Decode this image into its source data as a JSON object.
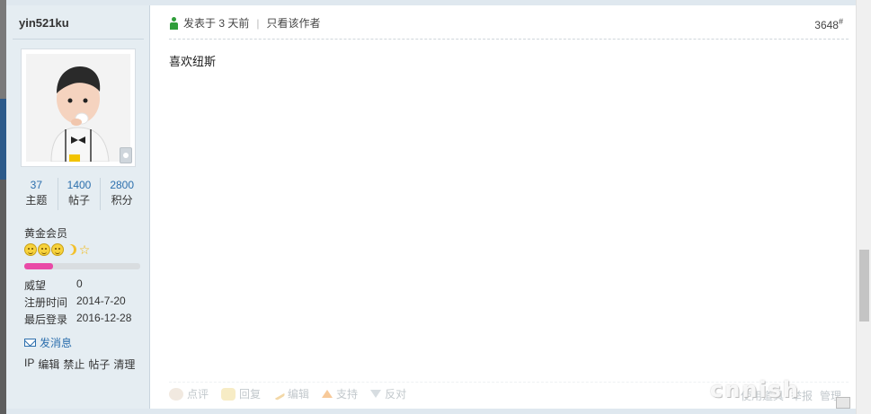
{
  "user": {
    "username": "yin521ku",
    "stats": [
      {
        "value": "37",
        "label": "主题"
      },
      {
        "value": "1400",
        "label": "帖子"
      },
      {
        "value": "2800",
        "label": "积分"
      }
    ],
    "level": "黄金会员",
    "level_progress": 0.25,
    "info": {
      "prestige_label": "威望",
      "prestige_value": "0",
      "registered_label": "注册时间",
      "registered_value": "2014-7-20",
      "last_login_label": "最后登录",
      "last_login_value": "2016-12-28"
    },
    "send_message": "发消息",
    "admin_links": [
      "IP",
      "编辑",
      "禁止",
      "帖子",
      "清理"
    ]
  },
  "post": {
    "posted": "发表于 3 天前",
    "author_only": "只看该作者",
    "floor": "3648",
    "floor_mark": "#",
    "content": "喜欢纽斯",
    "actions": [
      "点评",
      "回复",
      "编辑",
      "支持",
      "反对"
    ],
    "right_actions": [
      "使用道具",
      "举报",
      "管理"
    ]
  },
  "watermark": "cnnish",
  "colors": {
    "sidebar_bg": "#e5edf2",
    "link_blue": "#2c6fad",
    "progress_pink": "#e94aa7"
  }
}
